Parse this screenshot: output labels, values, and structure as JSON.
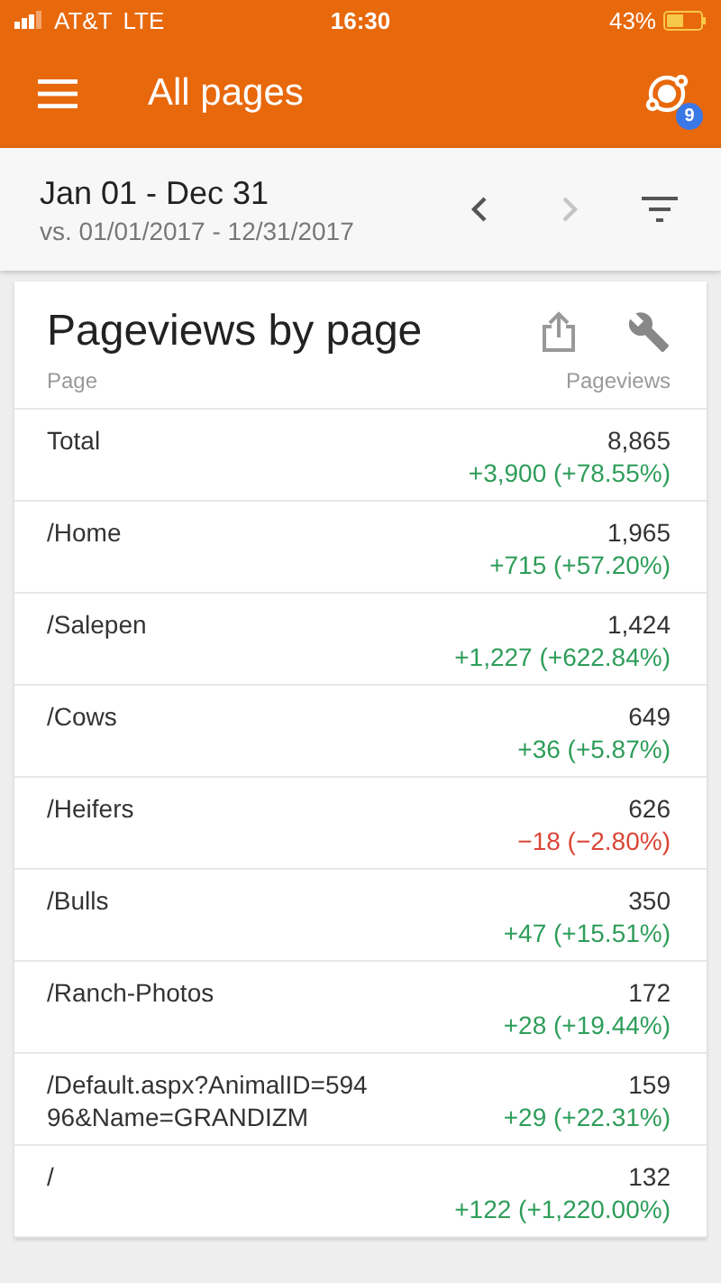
{
  "status_bar": {
    "carrier": "AT&T",
    "network": "LTE",
    "time": "16:30",
    "battery": "43%"
  },
  "app_bar": {
    "title": "All pages",
    "badge": "9"
  },
  "date_range": {
    "range": "Jan 01 - Dec 31",
    "comparison": "vs. 01/01/2017 - 12/31/2017",
    "prev_disabled": false,
    "next_disabled": true
  },
  "card": {
    "title": "Pageviews by page",
    "columns": [
      "Page",
      "Pageviews"
    ],
    "rows": [
      {
        "page": "Total",
        "value": "8,865",
        "change": "+3,900 (+78.55%)",
        "kind": "up"
      },
      {
        "page": "/Home",
        "value": "1,965",
        "change": "+715 (+57.20%)",
        "kind": "up"
      },
      {
        "page": "/Salepen",
        "value": "1,424",
        "change": "+1,227 (+622.84%)",
        "kind": "up"
      },
      {
        "page": "/Cows",
        "value": "649",
        "change": "+36 (+5.87%)",
        "kind": "up"
      },
      {
        "page": "/Heifers",
        "value": "626",
        "change": "−18 (−2.80%)",
        "kind": "down"
      },
      {
        "page": "/Bulls",
        "value": "350",
        "change": "+47 (+15.51%)",
        "kind": "up"
      },
      {
        "page": "/Ranch-Photos",
        "value": "172",
        "change": "+28 (+19.44%)",
        "kind": "up"
      },
      {
        "page": "/Default.aspx?AnimalID=59496&Name=GRANDIZM",
        "value": "159",
        "change": "+29 (+22.31%)",
        "kind": "up"
      },
      {
        "page": "/",
        "value": "132",
        "change": "+122 (+1,220.00%)",
        "kind": "up"
      }
    ]
  }
}
